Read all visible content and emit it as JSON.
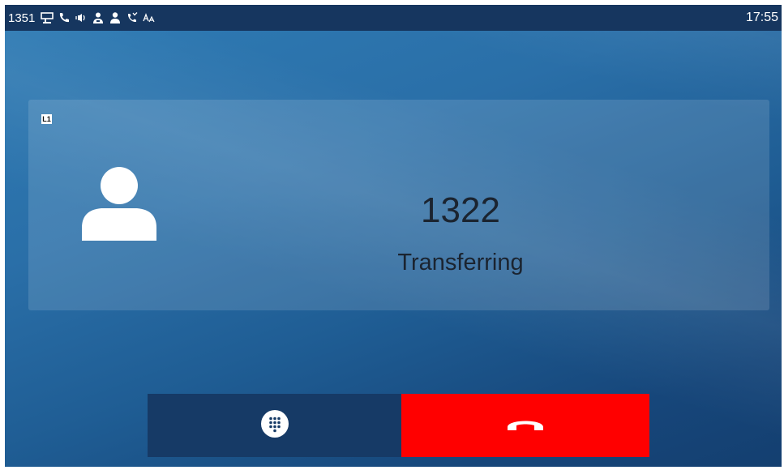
{
  "status_bar": {
    "account": "1351",
    "time": "17:55",
    "icons": [
      "desk-phone-icon",
      "phone-icon",
      "volume-icon",
      "contacts-icon",
      "user-icon",
      "missed-call-icon",
      "font-size-icon"
    ]
  },
  "call": {
    "line_label": "L1",
    "number": "1322",
    "status": "Transferring"
  },
  "buttons": {
    "dtmf_icon": "keypad-icon",
    "end_call_icon": "hang-up-icon"
  },
  "colors": {
    "status_bar": "#16365f",
    "end_call": "#ff0000",
    "dtmf_button": "#163a66"
  }
}
